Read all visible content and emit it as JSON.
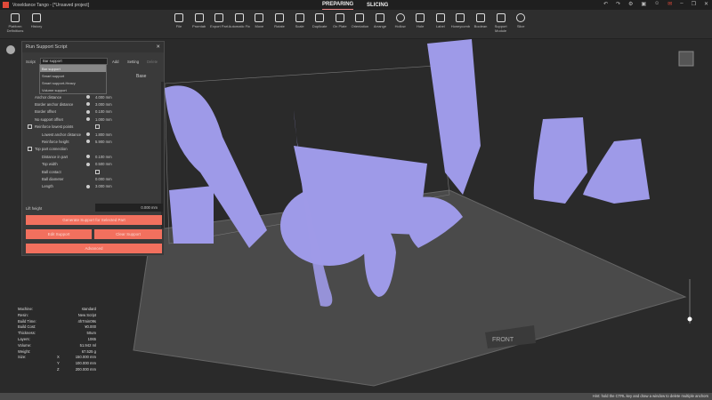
{
  "app": {
    "title": "Voxeldance Tango - [*Unsaved project]",
    "modes": [
      "PREPARING",
      "SLICING"
    ],
    "active_mode": "PREPARING"
  },
  "toolbar": {
    "left": [
      "Platform Definitions",
      "History"
    ],
    "tools": [
      "File",
      "Promtab",
      "Export Part",
      "Automatic Fix",
      "Move",
      "Rotate",
      "Scale",
      "Duplicate",
      "On Plate",
      "Orientation",
      "Arrange",
      "Hollow",
      "Hole",
      "Label",
      "Honeycomb",
      "Boolean",
      "Support Module",
      "Slice"
    ]
  },
  "panel": {
    "title": "Run Support Script",
    "script_label": "Script",
    "script_value": "Bar support",
    "add": "Add",
    "setting": "Setting",
    "delete": "Delete",
    "base": "Base",
    "dropdown": [
      "Bar support",
      "Smart support",
      "Smart support-Heavy",
      "Volume support"
    ],
    "rows": [
      {
        "label": "Anchor distance",
        "value": "4.000 mm"
      },
      {
        "label": "Border anchor distance",
        "value": "3.000 mm"
      },
      {
        "label": "Border offset",
        "value": "0.100 mm"
      },
      {
        "label": "No support offset",
        "value": "1.000 mm"
      },
      {
        "label": "Reinforce lowest points",
        "value": ""
      },
      {
        "label": "Lowest anchor distance",
        "value": "1.800 mm"
      },
      {
        "label": "Reinforce height",
        "value": "5.900 mm"
      },
      {
        "label": "Top part connection",
        "value": ""
      },
      {
        "label": "Distance in part",
        "value": "0.100 mm"
      },
      {
        "label": "Top width",
        "value": "0.500 mm"
      },
      {
        "label": "Ball contact",
        "value": ""
      },
      {
        "label": "Ball diameter",
        "value": "0.000 mm"
      },
      {
        "label": "Length",
        "value": "3.000 mm"
      }
    ],
    "lift_label": "Lift height",
    "lift_value": "0.000 mm",
    "generate": "Generate Support for Selected Part",
    "edit": "Edit Support",
    "clear": "Clear Support",
    "advanced": "Advanced"
  },
  "info": [
    [
      "Machine:",
      "",
      "standard"
    ],
    [
      "Resin:",
      "",
      "New Script"
    ],
    [
      "Build Time:",
      "",
      "4h7min09s"
    ],
    [
      "Build Cost:",
      "",
      "¥0.000"
    ],
    [
      "Thickness:",
      "",
      "50um"
    ],
    [
      "Layers:",
      "",
      "1065"
    ],
    [
      "Volume:",
      "",
      "51.942 ml"
    ],
    [
      "Weight:",
      "",
      "67.525 g"
    ],
    [
      "Size:",
      "X",
      "150.000 mm"
    ],
    [
      "",
      "Y",
      "100.000 mm"
    ],
    [
      "",
      "Z",
      "200.000 mm"
    ]
  ],
  "plate_label": "FRONT",
  "status": "Hint: hold the CTRL key and draw a window to delete multiple anchors",
  "colors": {
    "accent": "#f2705e",
    "model": "#9e9ae8",
    "background": "#2a2a2a"
  }
}
